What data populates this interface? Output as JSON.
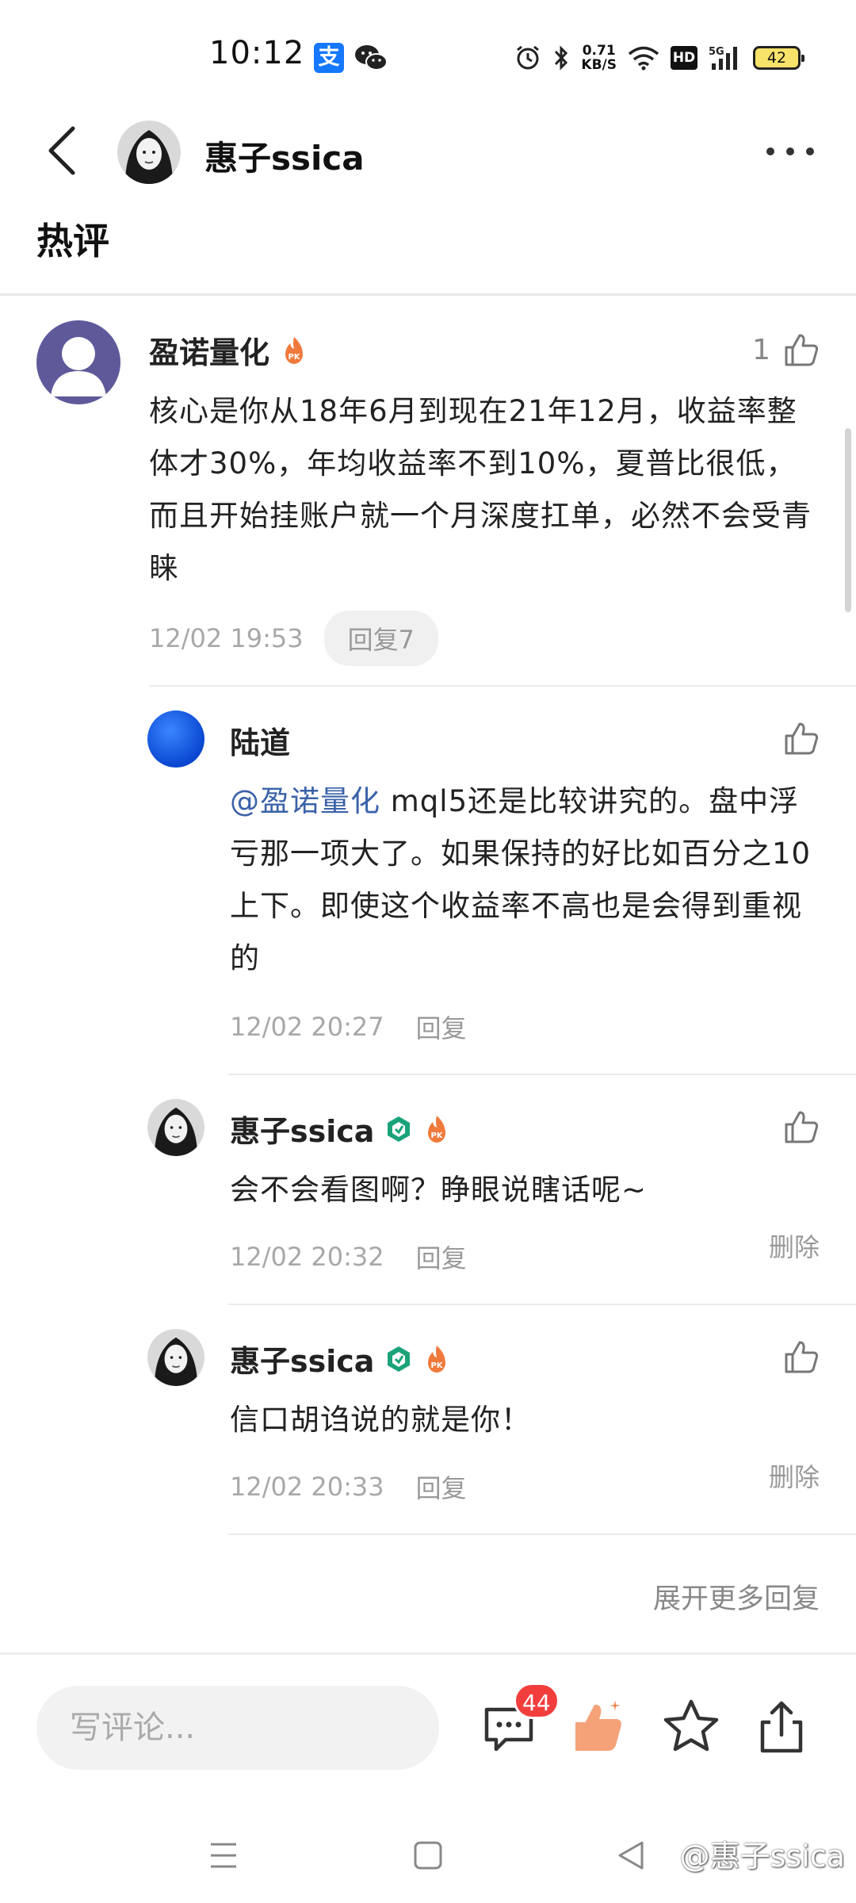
{
  "status_bar": {
    "time": "10:12",
    "alipay_icon_text": "支",
    "net_speed_value": "0.71",
    "net_speed_unit": "KB/S",
    "hd_label": "HD",
    "signal_label": "5G",
    "battery": "42"
  },
  "header": {
    "username": "惠子ssica"
  },
  "section_title": "热评",
  "main_comment": {
    "author": "盈诺量化",
    "badge": "PK",
    "like_count": "1",
    "text": "核心是你从18年6月到现在21年12月，收益率整体才30%，年均收益率不到10%，夏普比很低，而且开始挂账户就一个月深度扛单，必然不会受青睐",
    "time": "12/02 19:53",
    "reply_button": "回复7"
  },
  "replies": [
    {
      "author": "陆道",
      "mention": "@盈诺量化",
      "text": " mql5还是比较讲究的。盘中浮亏那一项大了。如果保持的好比如百分之10上下。即使这个收益率不高也是会得到重视的",
      "time": "12/02 20:27",
      "reply_label": "回复"
    },
    {
      "author": "惠子ssica",
      "badge": "PK",
      "text": "会不会看图啊？睁眼说瞎话呢~",
      "time": "12/02 20:32",
      "reply_label": "回复",
      "delete_label": "删除"
    },
    {
      "author": "惠子ssica",
      "badge": "PK",
      "text": "信口胡诌说的就是你！",
      "time": "12/02 20:33",
      "reply_label": "回复",
      "delete_label": "删除"
    }
  ],
  "expand_more": "展开更多回复",
  "bottom_bar": {
    "input_placeholder": "写评论...",
    "comment_count_badge": "44",
    "icons": [
      "comment-icon",
      "like-icon",
      "star-icon",
      "share-icon"
    ]
  },
  "watermark": "@惠子ssica",
  "colors": {
    "accent_orange": "#f07a3c",
    "mention_blue": "#3a62a8",
    "badge_red": "#f23d3d",
    "verified_green": "#1aa37a"
  }
}
